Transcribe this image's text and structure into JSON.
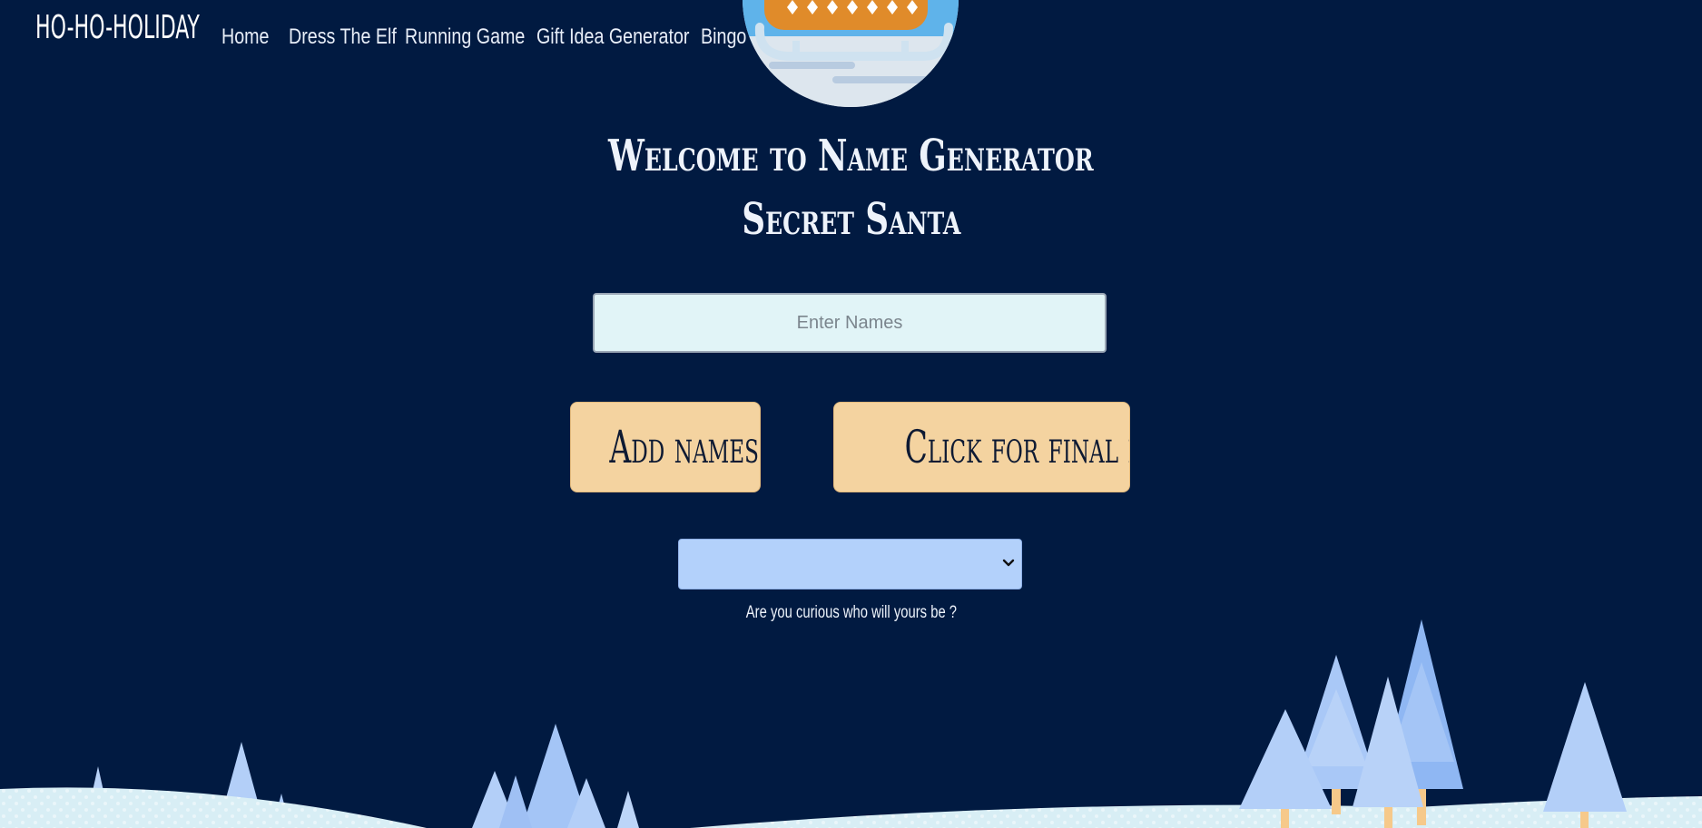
{
  "nav": {
    "brand": "HO-HO-HOLIDAY",
    "links": [
      "Home",
      "Dress The Elf",
      "Running Game",
      "Gift Idea Generator",
      "Bingo"
    ]
  },
  "main": {
    "title_line1": "Welcome to Name Generator",
    "title_line2": "Secret Santa",
    "names_input_placeholder": "Enter Names",
    "names_input_value": "",
    "add_button_label": "Add names",
    "final_button_label": "Click for final list",
    "select_value": "",
    "curious_text": "Are you curious who will yours be ?"
  },
  "icons": {
    "sleigh": "sleigh-icon",
    "chevron": "chevron-down-icon",
    "trees": "tree-icon"
  },
  "colors": {
    "background": "#011a41",
    "button": "#f4d3a0",
    "input": "#e1f4f7",
    "select": "#b3d1fb",
    "snow": "#dcf0f6"
  }
}
